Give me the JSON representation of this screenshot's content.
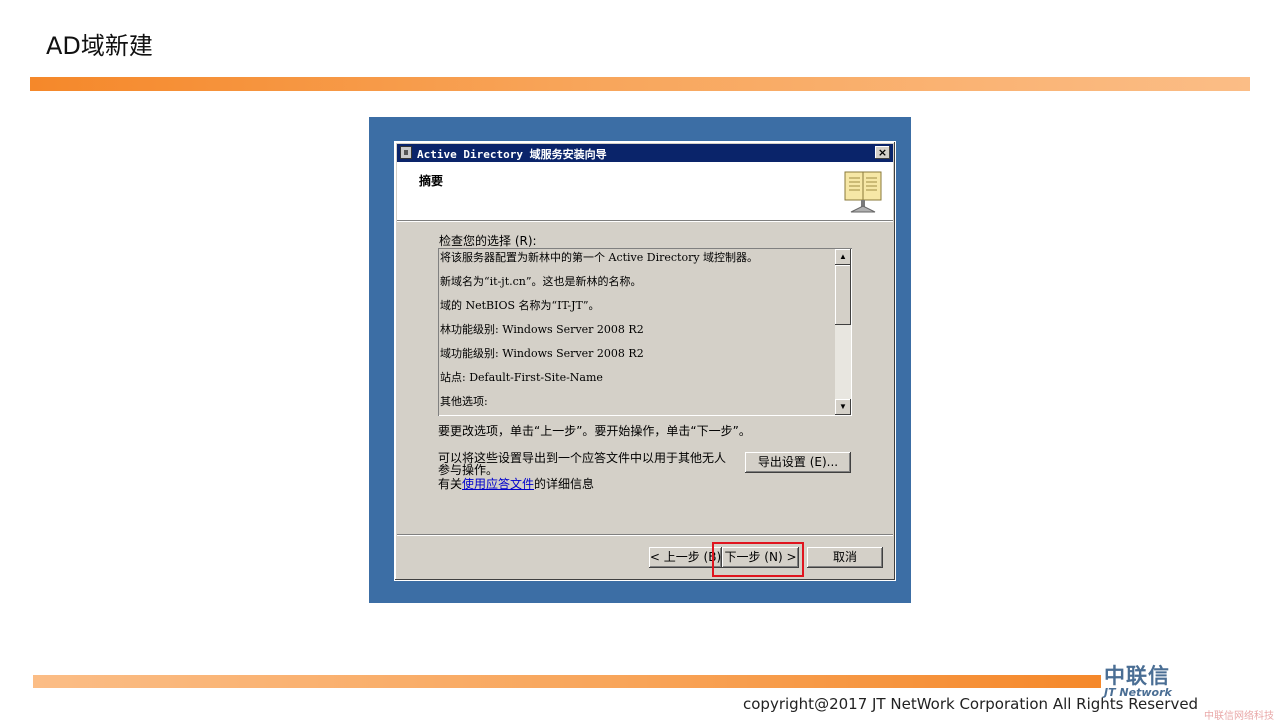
{
  "slide": {
    "title": "AD域新建",
    "accent_color": "#f5882a"
  },
  "dialog": {
    "title": "Active Directory 域服务安装向导",
    "header_title": "摘要",
    "review_label": "检查您的选择 (R):",
    "summary_lines": [
      "将该服务器配置为新林中的第一个 Active Directory 域控制器。",
      "新域名为“it-jt.cn”。这也是新林的名称。",
      "域的 NetBIOS 名称为“IT-JT”。",
      "林功能级别: Windows Server 2008 R2",
      "域功能级别: Windows Server 2008 R2",
      "站点: Default-First-Site-Name",
      "其他选项:"
    ],
    "instruction": "要更改选项，单击“上一步”。要开始操作，单击“下一步”。",
    "export_text_line1": "可以将这些设置导出到一个应答文件中以用于其他无人",
    "export_text_line2": "参与操作。",
    "export_button": "导出设置 (E)...",
    "help_prefix": "有关",
    "help_link": "使用应答文件",
    "help_suffix": "的详细信息",
    "back_button": "< 上一步 (B)",
    "next_button": "下一步 (N) >",
    "cancel_button": "取消",
    "highlight_color": "#e0141e"
  },
  "footer": {
    "logo_cn": "中联信",
    "logo_en": "JT Network",
    "copyright": "copyright@2017  JT NetWork Corporation All Rights Reserved",
    "watermark": "中联信网络科技"
  },
  "icons": [
    "window-app-icon",
    "close-icon",
    "book-icon",
    "scroll-up-icon",
    "scroll-down-icon"
  ]
}
